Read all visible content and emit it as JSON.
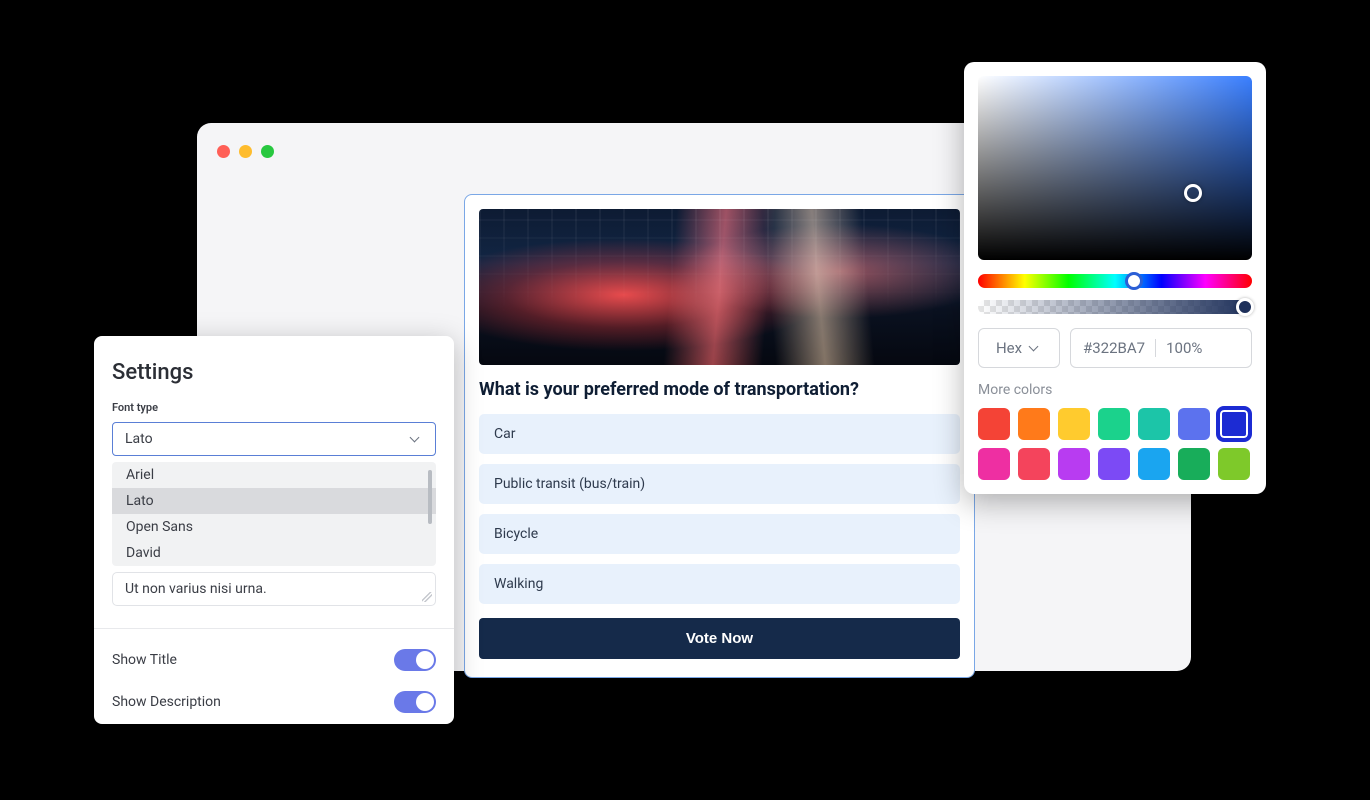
{
  "settings": {
    "title": "Settings",
    "font_type_label": "Font type",
    "font_selected": "Lato",
    "font_options": [
      "Ariel",
      "Lato",
      "Open Sans",
      "David"
    ],
    "textarea_value": "Ut non varius nisi urna.",
    "show_title_label": "Show Title",
    "show_title_on": true,
    "show_description_label": "Show Description",
    "show_description_on": true
  },
  "poll": {
    "question": "What is your preferred mode of transportation?",
    "options": [
      "Car",
      "Public transit (bus/train)",
      "Bicycle",
      "Walking"
    ],
    "vote_label": "Vote Now"
  },
  "color_picker": {
    "format_label": "Hex",
    "hex_value": "#322BA7",
    "alpha_label": "100%",
    "more_colors_label": "More colors",
    "swatches": [
      "#f44336",
      "#ff7a1a",
      "#ffcb2e",
      "#1bd28c",
      "#1cc5a8",
      "#5c72ee",
      "#1c2bd3",
      "#ee2fa2",
      "#f4445c",
      "#b83cf1",
      "#7c4af5",
      "#1aa5f0",
      "#18ad5a",
      "#7ec92a"
    ],
    "selected_swatch_index": 6
  }
}
